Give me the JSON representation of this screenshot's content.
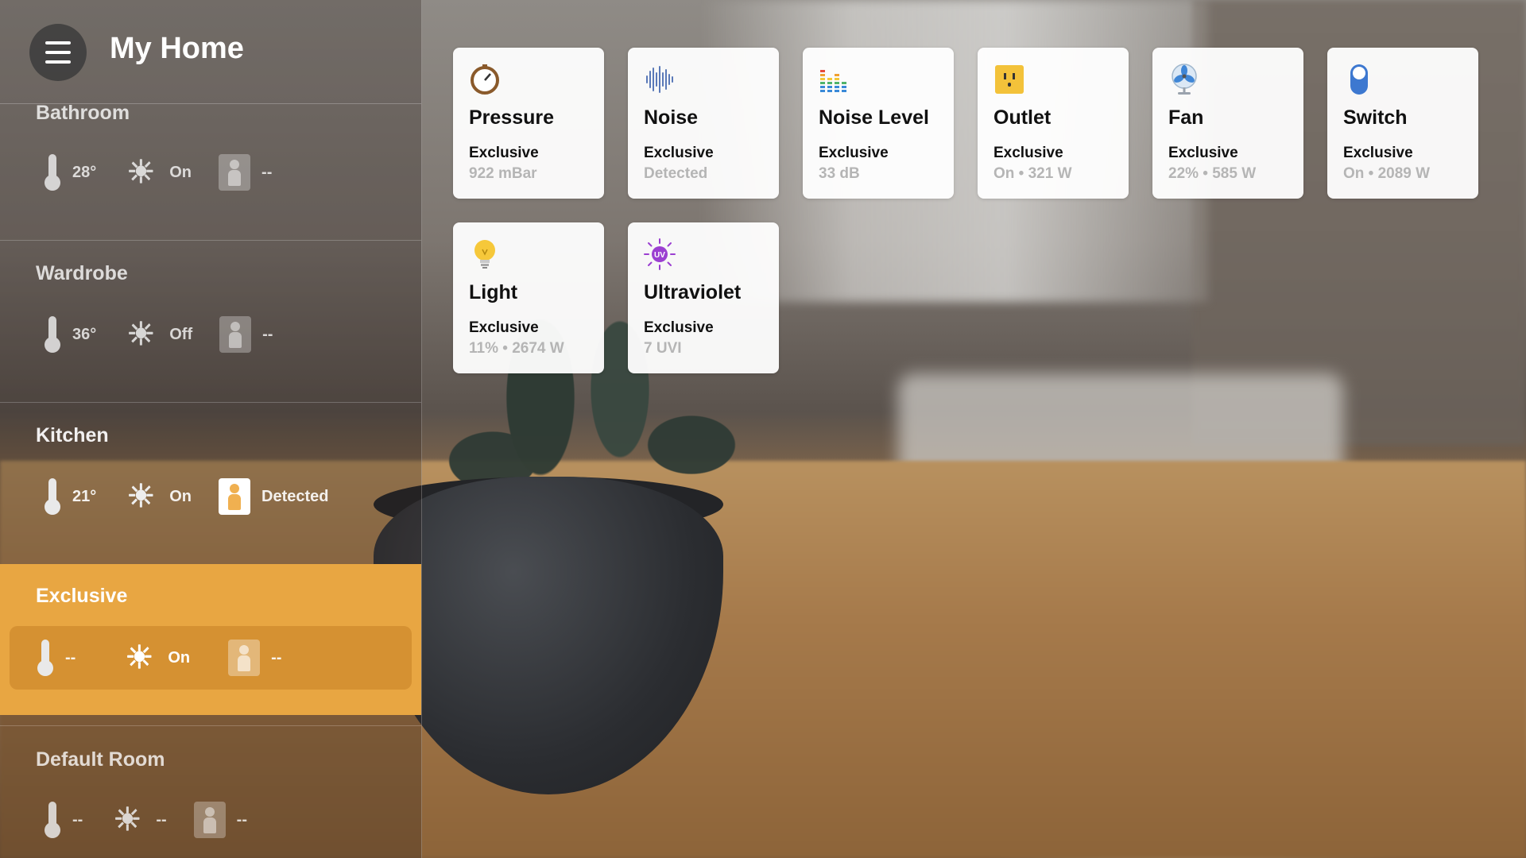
{
  "app": {
    "title": "My Home"
  },
  "rooms": [
    {
      "name": "Bathroom",
      "temperature": "28°",
      "light": "On",
      "motion": "--"
    },
    {
      "name": "Wardrobe",
      "temperature": "36°",
      "light": "Off",
      "motion": "--"
    },
    {
      "name": "Kitchen",
      "temperature": "21°",
      "light": "On",
      "motion": "Detected"
    },
    {
      "name": "Exclusive",
      "temperature": "--",
      "light": "On",
      "motion": "--"
    },
    {
      "name": "Default Room",
      "temperature": "--",
      "light": "--",
      "motion": "--"
    }
  ],
  "accessories": [
    {
      "name": "Pressure",
      "room": "Exclusive",
      "state": "922 mBar",
      "icon": "pressure-gauge-icon"
    },
    {
      "name": "Noise",
      "room": "Exclusive",
      "state": "Detected",
      "icon": "sound-wave-icon"
    },
    {
      "name": "Noise Level",
      "room": "Exclusive",
      "state": "33 dB",
      "icon": "equalizer-icon"
    },
    {
      "name": "Outlet",
      "room": "Exclusive",
      "state": "On • 321 W",
      "icon": "outlet-icon"
    },
    {
      "name": "Fan",
      "room": "Exclusive",
      "state": "22% • 585 W",
      "icon": "fan-icon"
    },
    {
      "name": "Switch",
      "room": "Exclusive",
      "state": "On • 2089 W",
      "icon": "switch-icon"
    },
    {
      "name": "Light",
      "room": "Exclusive",
      "state": "11% • 2674 W",
      "icon": "lightbulb-icon"
    },
    {
      "name": "Ultraviolet",
      "room": "Exclusive",
      "state": "7 UVI",
      "icon": "uv-sun-icon"
    }
  ],
  "colors": {
    "accent": "#e8a642",
    "card": "#ffffff"
  }
}
